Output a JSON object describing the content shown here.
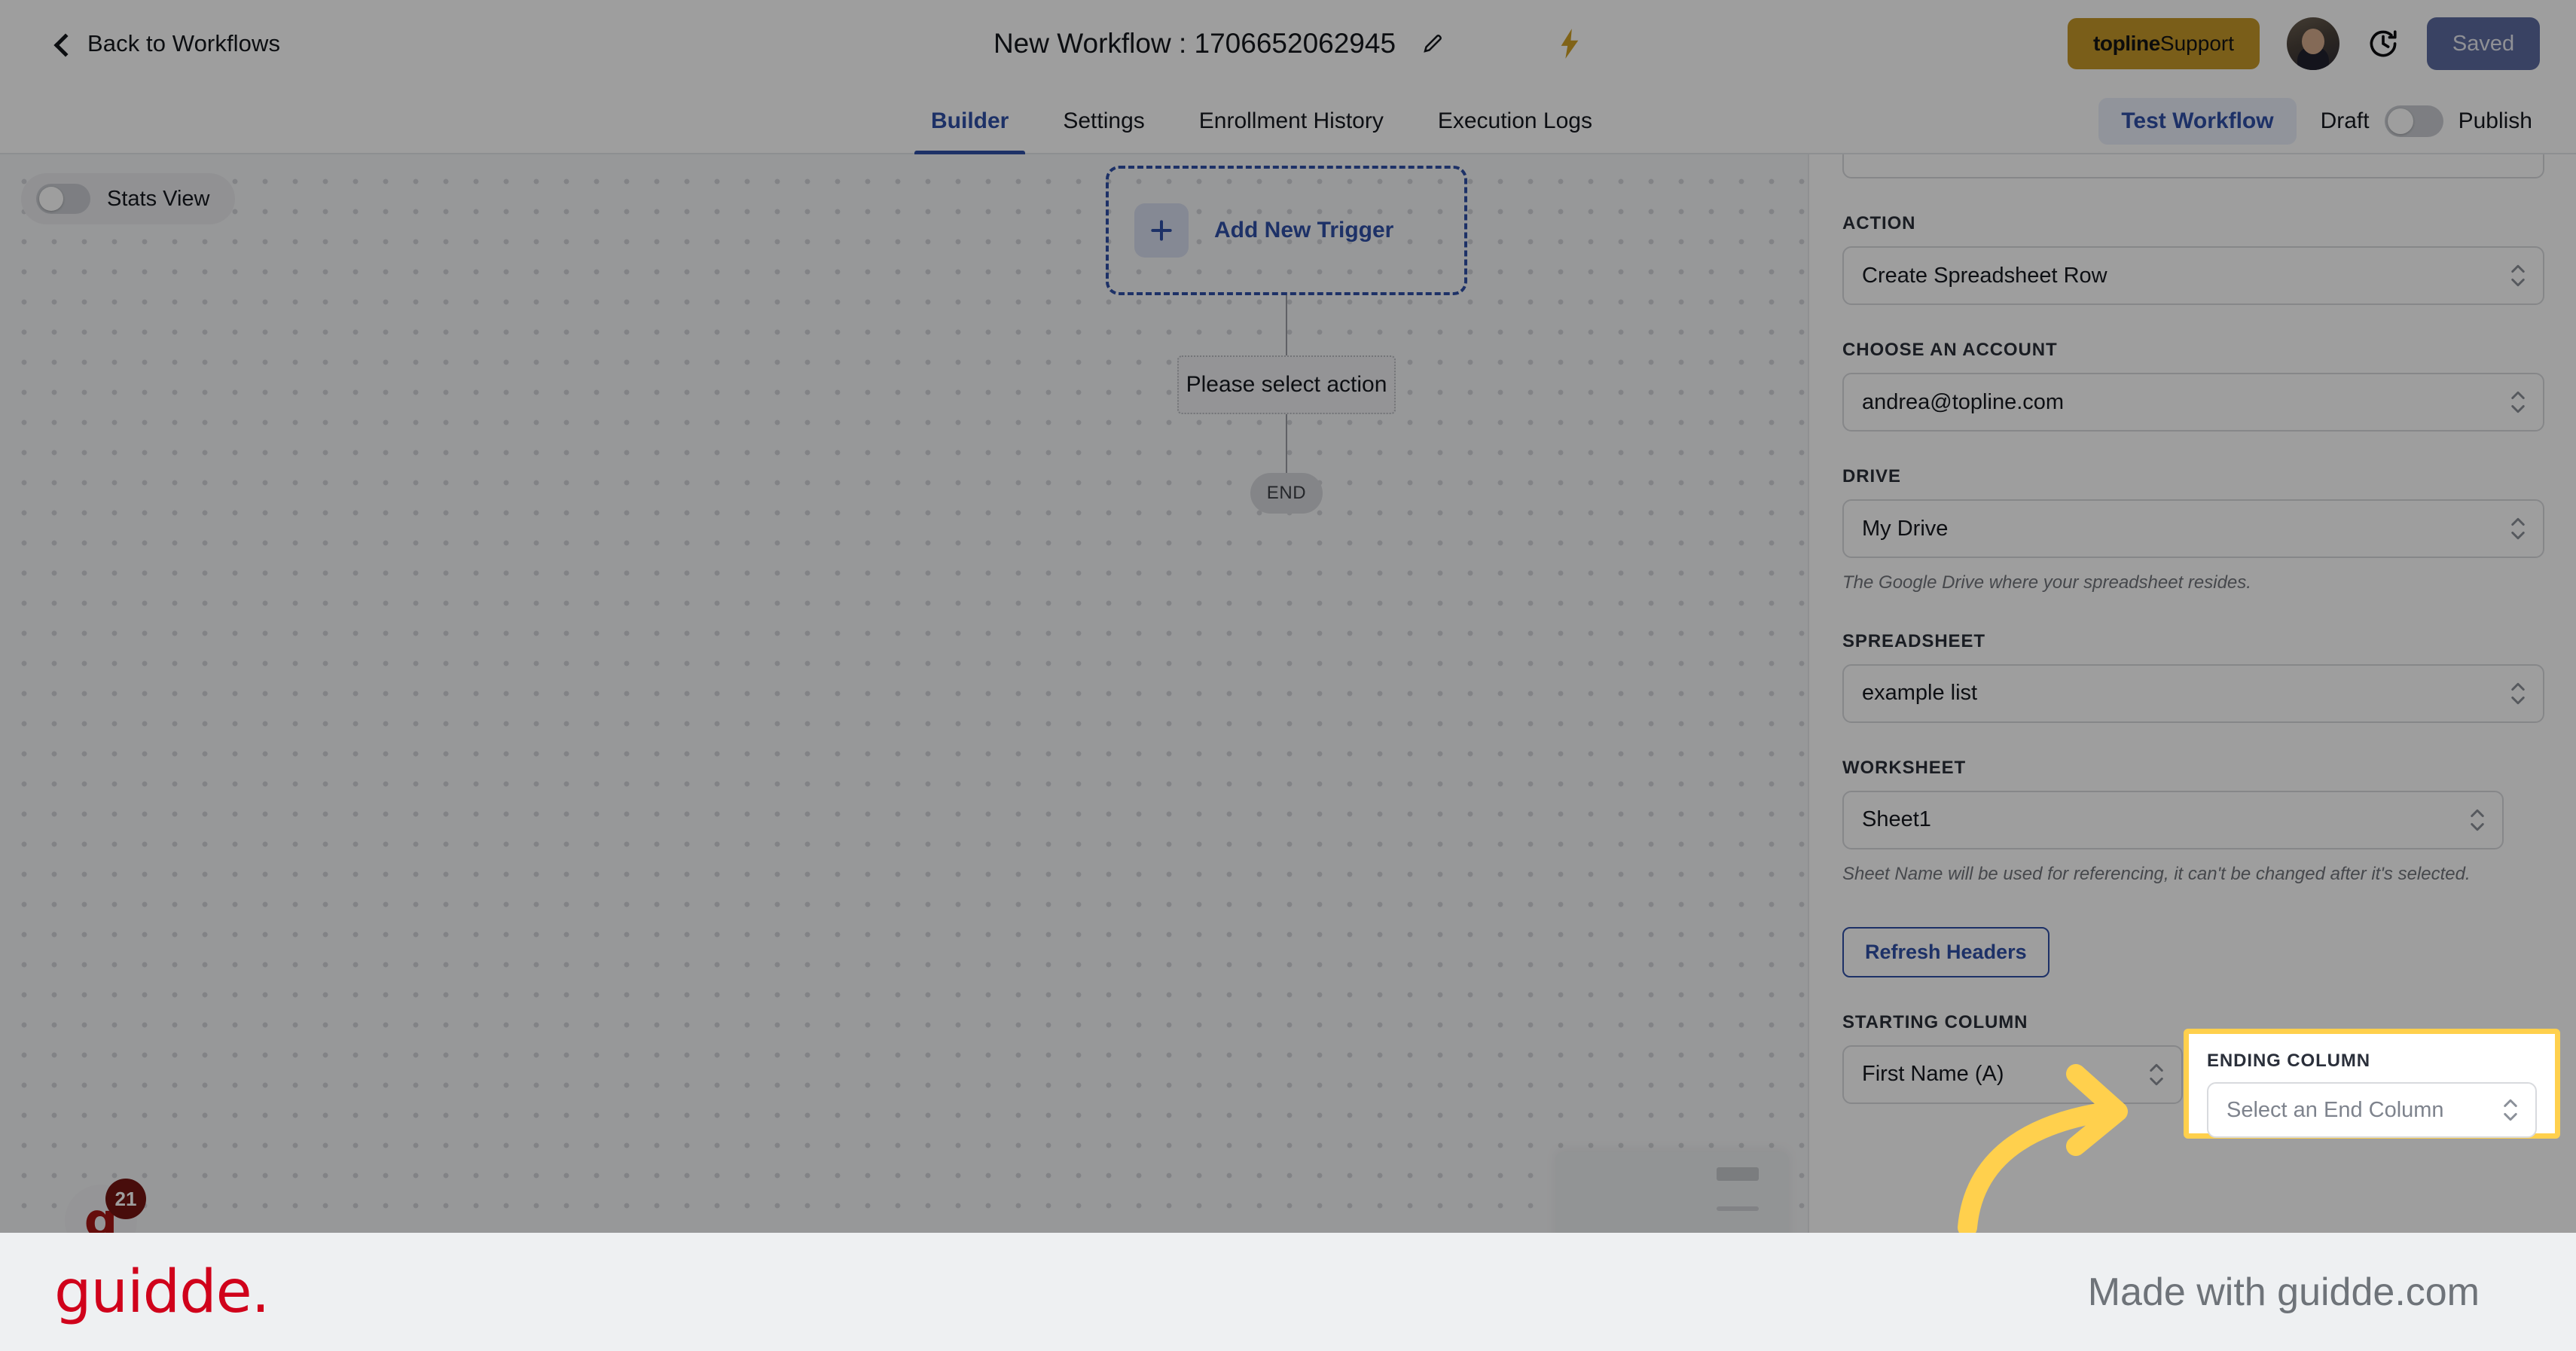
{
  "header": {
    "back_label": "Back to Workflows",
    "back_icon": "chevron-left-icon",
    "workflow_title": "New Workflow : 1706652062945",
    "edit_icon": "pencil-icon",
    "bolt_icon": "lightning-bolt-icon",
    "support_brand": "topline",
    "support_label": " Support",
    "avatar_name": "user-avatar",
    "history_icon": "clock-history-icon",
    "save_status": "Saved"
  },
  "tabs": [
    {
      "label": "Builder",
      "active": true
    },
    {
      "label": "Settings",
      "active": false
    },
    {
      "label": "Enrollment History",
      "active": false
    },
    {
      "label": "Execution Logs",
      "active": false
    }
  ],
  "tabbar_right": {
    "test_workflow": "Test Workflow",
    "draft_label": "Draft",
    "publish_label": "Publish",
    "publish_toggle_on": false
  },
  "canvas": {
    "stats_view_label": "Stats View",
    "stats_view_on": false,
    "add_trigger_label": "Add New Trigger",
    "plus_icon": "plus-icon",
    "select_action_label": "Please select action",
    "end_label": "END",
    "guidde_widget_letter": "g",
    "guidde_widget_badge": "21"
  },
  "panel": {
    "action": {
      "label": "ACTION",
      "value": "Create Spreadsheet Row"
    },
    "account": {
      "label": "CHOOSE AN ACCOUNT",
      "value": "andrea@topline.com"
    },
    "drive": {
      "label": "DRIVE",
      "value": "My Drive",
      "help": "The Google Drive where your spreadsheet resides."
    },
    "spreadsheet": {
      "label": "SPREADSHEET",
      "value": "example list"
    },
    "worksheet": {
      "label": "WORKSHEET",
      "value": "Sheet1",
      "help": "Sheet Name will be used for referencing, it can't be changed after it's selected."
    },
    "refresh_headers": "Refresh Headers",
    "starting_column": {
      "label": "STARTING COLUMN",
      "value": "First Name (A)"
    },
    "ending_column": {
      "label": "ENDING COLUMN",
      "placeholder": "Select an End Column"
    }
  },
  "callout": {
    "highlight_color": "#ffd04d",
    "arrow_color": "#ffd04d"
  },
  "footer": {
    "logo": "guidde.",
    "made_with": "Made with guidde.com"
  },
  "colors": {
    "accent_blue": "#2c4fb0",
    "support_gold": "#c9971b",
    "saved_blue": "#5b6ba6",
    "guidde_red": "#d0021b",
    "highlight_yellow": "#ffd04d"
  }
}
